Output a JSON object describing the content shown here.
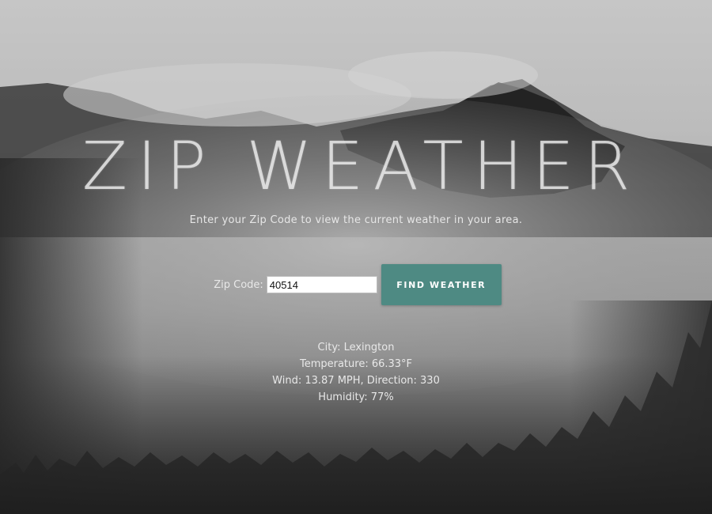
{
  "header": {
    "title": "ZIP WEATHER",
    "subtitle": "Enter your Zip Code to view the current weather in your area."
  },
  "form": {
    "zip_label": "Zip Code:",
    "zip_value": "40514",
    "button_label": "FIND WEATHER"
  },
  "results": {
    "city": "City: Lexington",
    "temperature": "Temperature: 66.33°F",
    "wind": "Wind: 13.87 MPH, Direction: 330",
    "humidity": "Humidity: 77%"
  },
  "colors": {
    "button": "#4e8a83",
    "text": "#e8e8e8"
  }
}
